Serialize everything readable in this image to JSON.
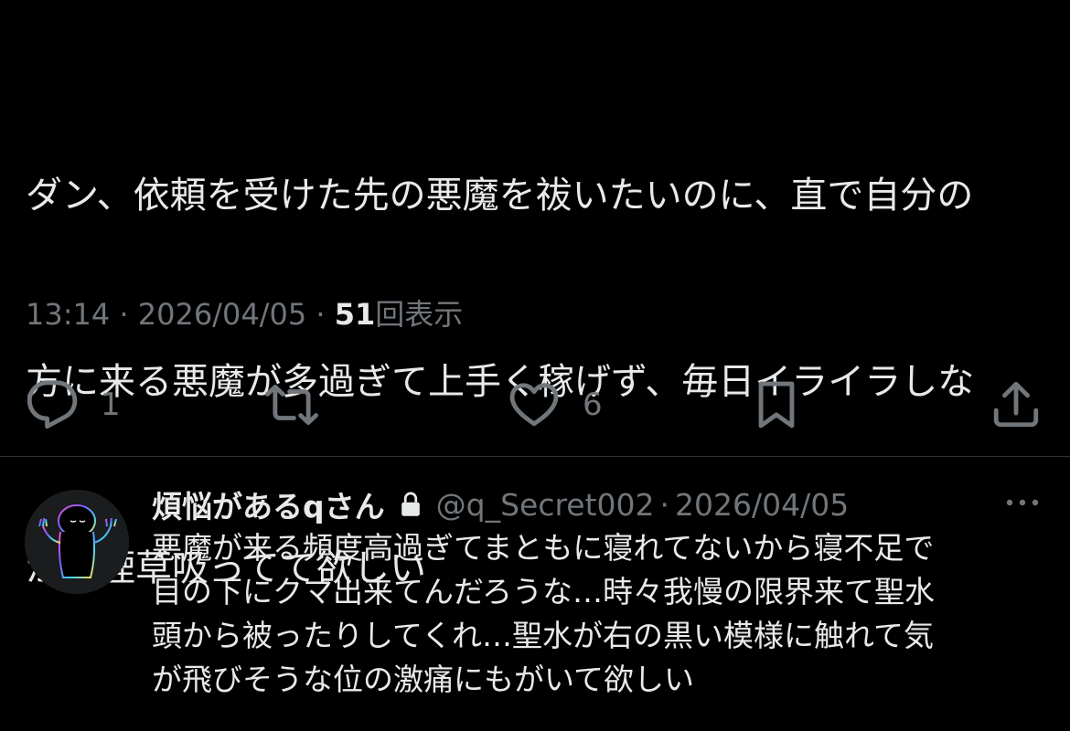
{
  "post": {
    "text_lines": [
      "ダン、依頼を受けた先の悪魔を祓いたいのに、直で自分の",
      "方に来る悪魔が多過ぎて上手く稼げず、毎日イライラしな",
      "がら煙草吸ってて欲しい"
    ],
    "time": "13:14",
    "date": "2026/04/05",
    "dot": "·",
    "views_count": "51",
    "views_label": "回表示"
  },
  "actions": {
    "reply_icon": "speech-bubble-icon",
    "reply_count": "1",
    "repost_icon": "repost-arrows-icon",
    "like_icon": "heart-icon",
    "like_count": "6",
    "bookmark_icon": "bookmark-icon",
    "share_icon": "share-upload-icon"
  },
  "reply": {
    "display_name": "煩悩があるqさん",
    "lock_icon": "lock-icon",
    "handle": "@q_Secret002",
    "dot": "·",
    "date": "2026/04/05",
    "more_icon": "ellipsis-icon",
    "text_lines": [
      "悪魔が来る頻度高過ぎてまともに寝れてないから寝不足で",
      "目の下にクマ出来てんだろうな…時々我慢の限界来て聖水",
      "頭から被ったりしてくれ…聖水が右の黒い模様に触れて気",
      "が飛びそうな位の激痛にもがいて欲しい"
    ]
  },
  "colors": {
    "background": "#000000",
    "text": "#e7e9ea",
    "muted": "#71767b",
    "divider": "#2f3336"
  }
}
